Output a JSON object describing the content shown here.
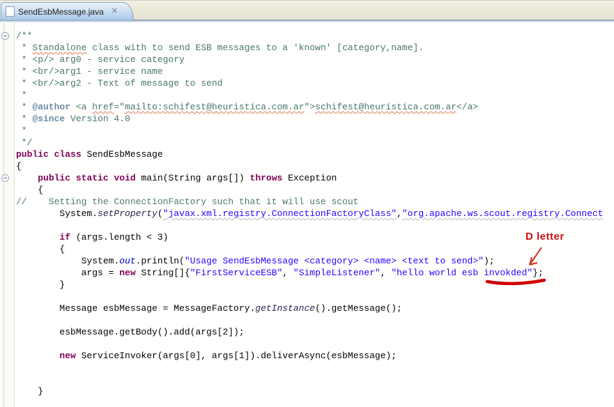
{
  "tab": {
    "title": "SendEsbMessage.java",
    "close_glyph": "✕"
  },
  "annotation": {
    "label": "D letter",
    "color": "#cc1111"
  },
  "colors": {
    "keyword": "#7f0055",
    "string": "#2a00ff",
    "javadoc": "#467869",
    "comment": "#4a7a6c",
    "tab_gradient_top": "#eaf2fb",
    "tab_gradient_bottom": "#a5c6e7",
    "tabbar_background": "#ece9d8"
  },
  "editor": {
    "lines": [
      {
        "fold": true,
        "tokens": [
          {
            "t": "/**",
            "c": "jd"
          }
        ]
      },
      {
        "tokens": [
          {
            "t": " * ",
            "c": "jd"
          },
          {
            "t": "Standalone",
            "c": "jd sqr"
          },
          {
            "t": " class with to send ESB messages to a 'known' [category,name].",
            "c": "jd"
          }
        ]
      },
      {
        "tokens": [
          {
            "t": " * <p/> arg0 - service category",
            "c": "jd"
          }
        ]
      },
      {
        "tokens": [
          {
            "t": " * <br/>arg1 - service name",
            "c": "jd"
          }
        ]
      },
      {
        "tokens": [
          {
            "t": " * <br/>arg2 - Text of message to send",
            "c": "jd"
          }
        ]
      },
      {
        "tokens": [
          {
            "t": " *",
            "c": "jd"
          }
        ]
      },
      {
        "tokens": [
          {
            "t": " * ",
            "c": "jd"
          },
          {
            "t": "@author",
            "c": "jt"
          },
          {
            "t": " <a ",
            "c": "jd"
          },
          {
            "t": "href",
            "c": "jd sqr"
          },
          {
            "t": "=\"",
            "c": "jd"
          },
          {
            "t": "mailto:schifest@heuristica.com.ar",
            "c": "jd sqr"
          },
          {
            "t": "\">",
            "c": "jd"
          },
          {
            "t": "schifest@heuristica.com.ar",
            "c": "jd sqr"
          },
          {
            "t": "</a>",
            "c": "jd"
          }
        ]
      },
      {
        "tokens": [
          {
            "t": " * ",
            "c": "jd"
          },
          {
            "t": "@since",
            "c": "jt"
          },
          {
            "t": " Version 4.0",
            "c": "jd"
          }
        ]
      },
      {
        "tokens": [
          {
            "t": " *",
            "c": "jd"
          }
        ]
      },
      {
        "tokens": [
          {
            "t": " */",
            "c": "jd"
          }
        ]
      },
      {
        "tokens": [
          {
            "t": "public",
            "c": "kw"
          },
          {
            "t": " "
          },
          {
            "t": "class",
            "c": "kw"
          },
          {
            "t": " SendEsbMessage"
          }
        ]
      },
      {
        "tokens": [
          {
            "t": "{"
          }
        ]
      },
      {
        "fold": true,
        "tokens": [
          {
            "t": "    "
          },
          {
            "t": "public",
            "c": "kw"
          },
          {
            "t": " "
          },
          {
            "t": "static",
            "c": "kw"
          },
          {
            "t": " "
          },
          {
            "t": "void",
            "c": "kw"
          },
          {
            "t": " main(String args[]) "
          },
          {
            "t": "throws",
            "c": "kw"
          },
          {
            "t": " Exception"
          }
        ]
      },
      {
        "tokens": [
          {
            "t": "    {"
          }
        ]
      },
      {
        "tokens": [
          {
            "t": "//    Setting the ConnectionFactory such that it will use scout",
            "c": "cm"
          }
        ]
      },
      {
        "tokens": [
          {
            "t": "        System."
          },
          {
            "t": "setProperty",
            "c": "sm"
          },
          {
            "t": "("
          },
          {
            "t": "\"javax.xml.registry.ConnectionFactoryClass\"",
            "c": "st sqg"
          },
          {
            "t": ","
          },
          {
            "t": "\"org.apache.ws.scout.registry.Connect",
            "c": "st sqg"
          }
        ]
      },
      {
        "tokens": []
      },
      {
        "tokens": [
          {
            "t": "        "
          },
          {
            "t": "if",
            "c": "kw"
          },
          {
            "t": " (args.length < 3)"
          }
        ]
      },
      {
        "tokens": [
          {
            "t": "        {"
          }
        ]
      },
      {
        "tokens": [
          {
            "t": "            System."
          },
          {
            "t": "out",
            "c": "sf"
          },
          {
            "t": ".println("
          },
          {
            "t": "\"Usage SendEsbMessage <category> <name> <text to send>\"",
            "c": "st"
          },
          {
            "t": ");"
          }
        ]
      },
      {
        "tokens": [
          {
            "t": "            args = "
          },
          {
            "t": "new",
            "c": "kw"
          },
          {
            "t": " String[]{"
          },
          {
            "t": "\"FirstServiceESB\"",
            "c": "st"
          },
          {
            "t": ", "
          },
          {
            "t": "\"SimpleListener\"",
            "c": "st"
          },
          {
            "t": ", "
          },
          {
            "t": "\"hello world esb invokded\"",
            "c": "st"
          },
          {
            "t": "};"
          }
        ]
      },
      {
        "tokens": [
          {
            "t": "        }"
          }
        ]
      },
      {
        "tokens": []
      },
      {
        "tokens": [
          {
            "t": "        Message esbMessage = MessageFactory."
          },
          {
            "t": "getInstance",
            "c": "sm"
          },
          {
            "t": "().getMessage();"
          }
        ]
      },
      {
        "tokens": []
      },
      {
        "tokens": [
          {
            "t": "        esbMessage.getBody().add(args[2]);"
          }
        ]
      },
      {
        "tokens": []
      },
      {
        "tokens": [
          {
            "t": "        "
          },
          {
            "t": "new",
            "c": "kw"
          },
          {
            "t": " ServiceInvoker(args[0], args[1]).deliverAsync(esbMessage);"
          }
        ]
      },
      {
        "tokens": []
      },
      {
        "tokens": []
      },
      {
        "tokens": [
          {
            "t": "    }"
          }
        ]
      }
    ]
  }
}
